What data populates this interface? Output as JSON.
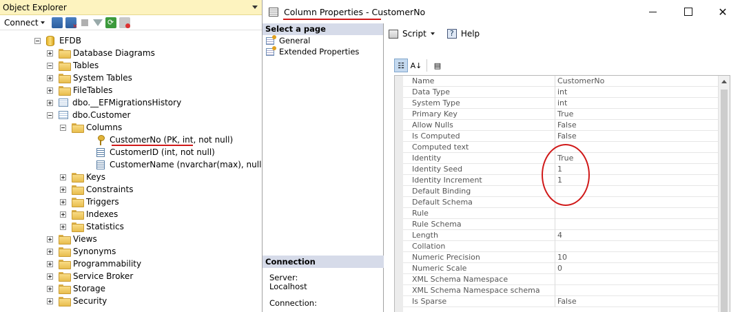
{
  "object_explorer": {
    "title": "Object Explorer",
    "toolbar": {
      "connect_label": "Connect"
    },
    "tree": [
      {
        "label": "EFDB",
        "icon": "database-icon",
        "expander": "minus",
        "level": 0
      },
      {
        "label": "Database Diagrams",
        "icon": "folder-icon",
        "expander": "plus",
        "level": 1
      },
      {
        "label": "Tables",
        "icon": "folder-icon",
        "expander": "minus",
        "level": 1
      },
      {
        "label": "System Tables",
        "icon": "folder-icon",
        "expander": "plus",
        "level": 2
      },
      {
        "label": "FileTables",
        "icon": "folder-icon",
        "expander": "plus",
        "level": 2
      },
      {
        "label": "dbo.__EFMigrationsHistory",
        "icon": "table-icon",
        "expander": "plus",
        "level": 2
      },
      {
        "label": "dbo.Customer",
        "icon": "table-icon",
        "expander": "minus",
        "level": 2
      },
      {
        "label": "Columns",
        "icon": "folder-icon",
        "expander": "minus",
        "level": 3
      },
      {
        "label": "CustomerNo (PK, int, not null)",
        "icon": "primary-key-icon",
        "expander": "none",
        "level": 4
      },
      {
        "label": "CustomerID (int, not null)",
        "icon": "column-icon",
        "expander": "none",
        "level": 4
      },
      {
        "label": "CustomerName (nvarchar(max), null)",
        "icon": "column-icon",
        "expander": "none",
        "level": 4
      },
      {
        "label": "Keys",
        "icon": "folder-icon",
        "expander": "plus",
        "level": 3
      },
      {
        "label": "Constraints",
        "icon": "folder-icon",
        "expander": "plus",
        "level": 3
      },
      {
        "label": "Triggers",
        "icon": "folder-icon",
        "expander": "plus",
        "level": 3
      },
      {
        "label": "Indexes",
        "icon": "folder-icon",
        "expander": "plus",
        "level": 3
      },
      {
        "label": "Statistics",
        "icon": "folder-icon",
        "expander": "plus",
        "level": 3
      },
      {
        "label": "Views",
        "icon": "folder-icon",
        "expander": "plus",
        "level": 1
      },
      {
        "label": "Synonyms",
        "icon": "folder-icon",
        "expander": "plus",
        "level": 1
      },
      {
        "label": "Programmability",
        "icon": "folder-icon",
        "expander": "plus",
        "level": 1
      },
      {
        "label": "Service Broker",
        "icon": "folder-icon",
        "expander": "plus",
        "level": 1
      },
      {
        "label": "Storage",
        "icon": "folder-icon",
        "expander": "plus",
        "level": 1
      },
      {
        "label": "Security",
        "icon": "folder-icon",
        "expander": "plus",
        "level": 1
      }
    ]
  },
  "dialog": {
    "title": "Column Properties - CustomerNo",
    "select_page_header": "Select a page",
    "pages": [
      "General",
      "Extended Properties"
    ],
    "connection_header": "Connection",
    "server_label": "Server:",
    "server_value": "Localhost",
    "connection_label": "Connection:",
    "toolbar": {
      "script_label": "Script",
      "help_label": "Help"
    },
    "properties": [
      {
        "name": "Name",
        "value": "CustomerNo"
      },
      {
        "name": "Data Type",
        "value": "int"
      },
      {
        "name": "System Type",
        "value": "int"
      },
      {
        "name": "Primary Key",
        "value": "True"
      },
      {
        "name": "Allow Nulls",
        "value": "False"
      },
      {
        "name": "Is Computed",
        "value": "False"
      },
      {
        "name": "Computed text",
        "value": ""
      },
      {
        "name": "Identity",
        "value": "True"
      },
      {
        "name": "Identity Seed",
        "value": "1"
      },
      {
        "name": "Identity Increment",
        "value": "1"
      },
      {
        "name": "Default Binding",
        "value": ""
      },
      {
        "name": "Default Schema",
        "value": ""
      },
      {
        "name": "Rule",
        "value": ""
      },
      {
        "name": "Rule Schema",
        "value": ""
      },
      {
        "name": "Length",
        "value": "4"
      },
      {
        "name": "Collation",
        "value": ""
      },
      {
        "name": "Numeric Precision",
        "value": "10"
      },
      {
        "name": "Numeric Scale",
        "value": "0"
      },
      {
        "name": "XML Schema Namespace",
        "value": ""
      },
      {
        "name": "XML Schema Namespace schema",
        "value": ""
      },
      {
        "name": "Is Sparse",
        "value": "False"
      }
    ]
  },
  "colors": {
    "title_bar": "#fdf3bf",
    "section_header": "#d6dbe9",
    "annotation": "#d01818"
  }
}
